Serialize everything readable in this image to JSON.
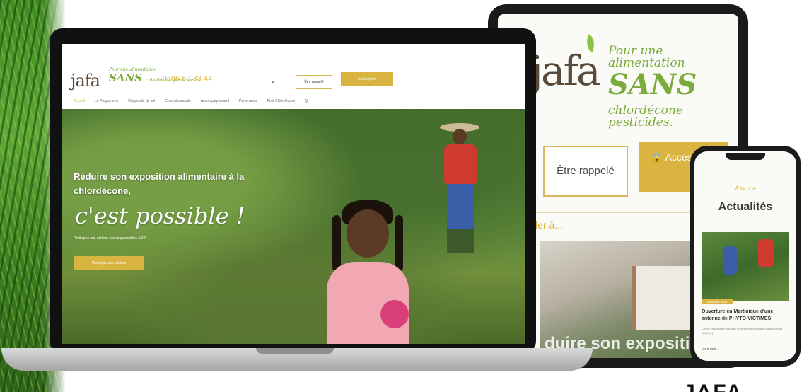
{
  "tablet": {
    "logo": "jafa",
    "slogan_line1": "Pour une alimentation",
    "slogan_sans": "SANS",
    "slogan_line2": "chlordécone pesticides.",
    "call_button": "Être rappelé",
    "access_button": "Accès privé",
    "menu_hint": "ller à...",
    "photo_text": "duire son exposition"
  },
  "laptop": {
    "logo": "jafa",
    "slogan_line1": "Pour une alimentation",
    "slogan_sans": "SANS",
    "slogan_line2": "chlordécone pesticides",
    "phone": "0696 50 33 44",
    "call_button": "Être rappelé",
    "access_button": "Accès privé",
    "nav": [
      "Accueil",
      "Le Programme",
      "Diagnostic de sol",
      "Chlordéconomie",
      "Accompagnement",
      "Partenaires",
      "Post Chlordécone",
      "Q"
    ],
    "hero_title": "Réduire son exposition alimentaire à la chlordécone,",
    "hero_script": "c'est possible !",
    "hero_sub": "Participez aux ateliers éco-responsables JAFA",
    "hero_button": "Participer aux ateliers"
  },
  "phone": {
    "kicker": "À la une",
    "title": "Actualités",
    "badge": "Actualités JAFA",
    "headline": "Ouverture en Martinique d'une antenne de PHYTO-VICTIMES",
    "body": "Lorem ipsum texte actualité présentée à destination des lecteurs JAFA [...]",
    "more": "Lire la suite →"
  },
  "corner_text": "JAFA",
  "colors": {
    "gold": "#d9b440",
    "green": "#7bab3a",
    "brown": "#5a4a3a"
  }
}
